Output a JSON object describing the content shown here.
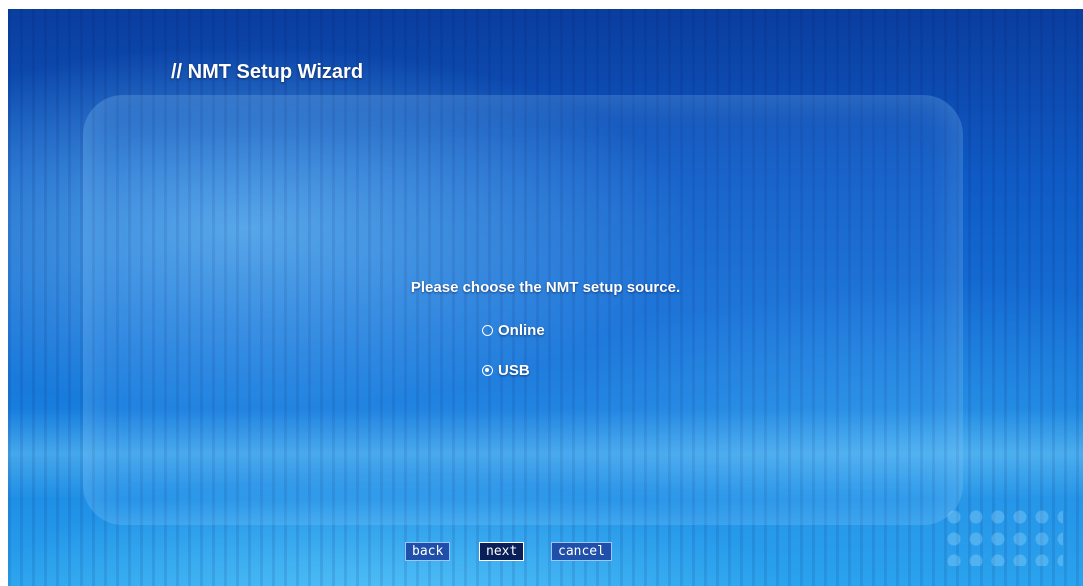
{
  "wizard": {
    "title": "// NMT Setup Wizard",
    "prompt": "Please choose the NMT setup source.",
    "options": [
      {
        "label": "Online",
        "selected": false
      },
      {
        "label": "USB",
        "selected": true
      }
    ]
  },
  "buttons": {
    "back": "back",
    "next": "next",
    "cancel": "cancel"
  }
}
